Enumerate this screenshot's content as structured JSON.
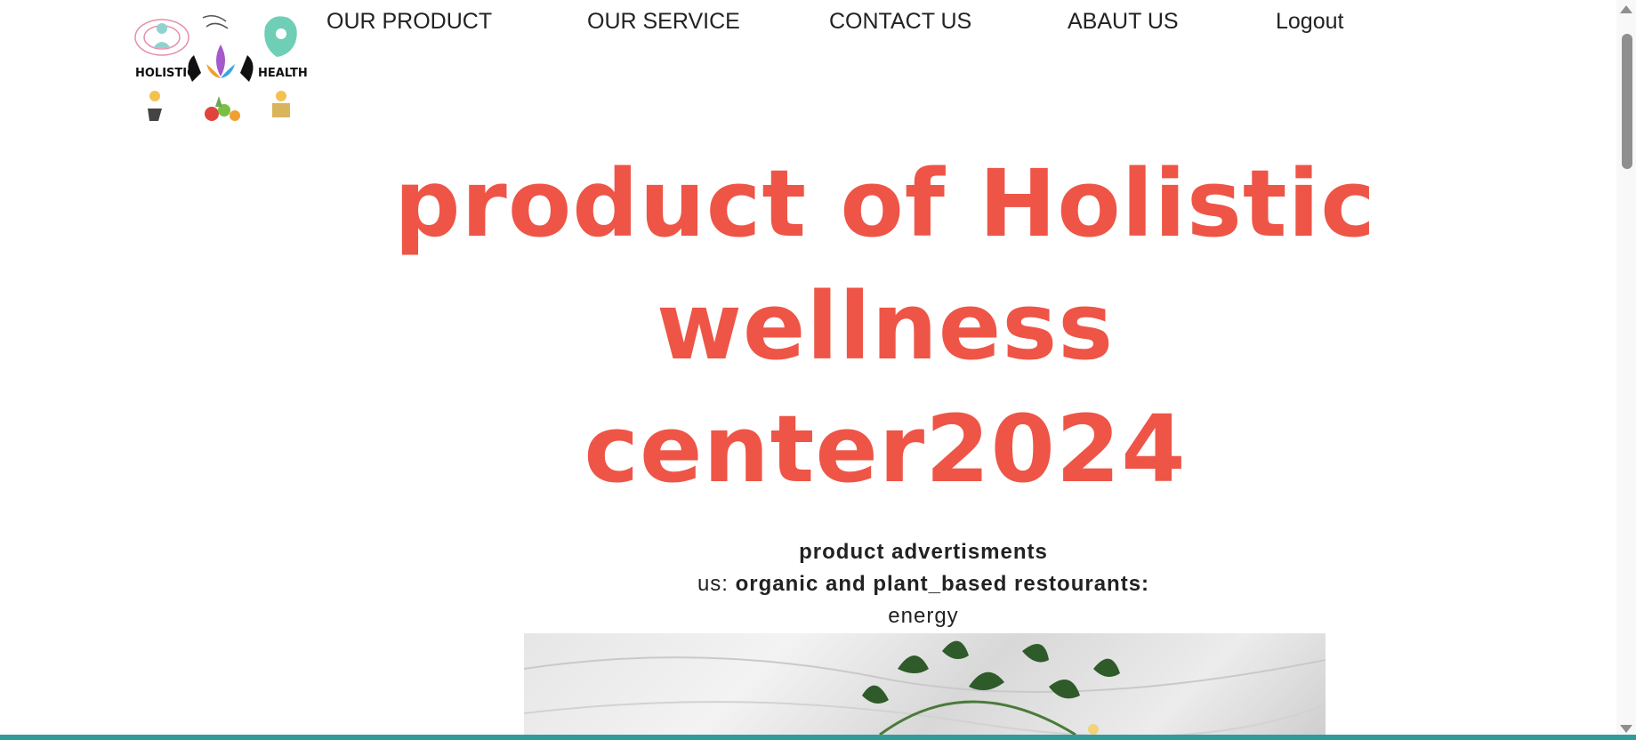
{
  "logo": {
    "left_text": "HOLISTIC",
    "right_text": "HEALTH"
  },
  "nav": {
    "product": "OUR PRODUCT",
    "service": "OUR SERVICE",
    "contact": "CONTACT US",
    "about": "ABAUT US",
    "logout": "Logout"
  },
  "hero": {
    "line1": "product of Holistic",
    "line2": "wellness",
    "line3": "center2024"
  },
  "info": {
    "heading": "product advertisments",
    "prefix": "us:",
    "restaurants": "organic and plant_based restourants:",
    "energy": "energy"
  },
  "colors": {
    "accent": "#ee5547",
    "text": "#222222",
    "bottom_bar": "#2f9c9a"
  }
}
